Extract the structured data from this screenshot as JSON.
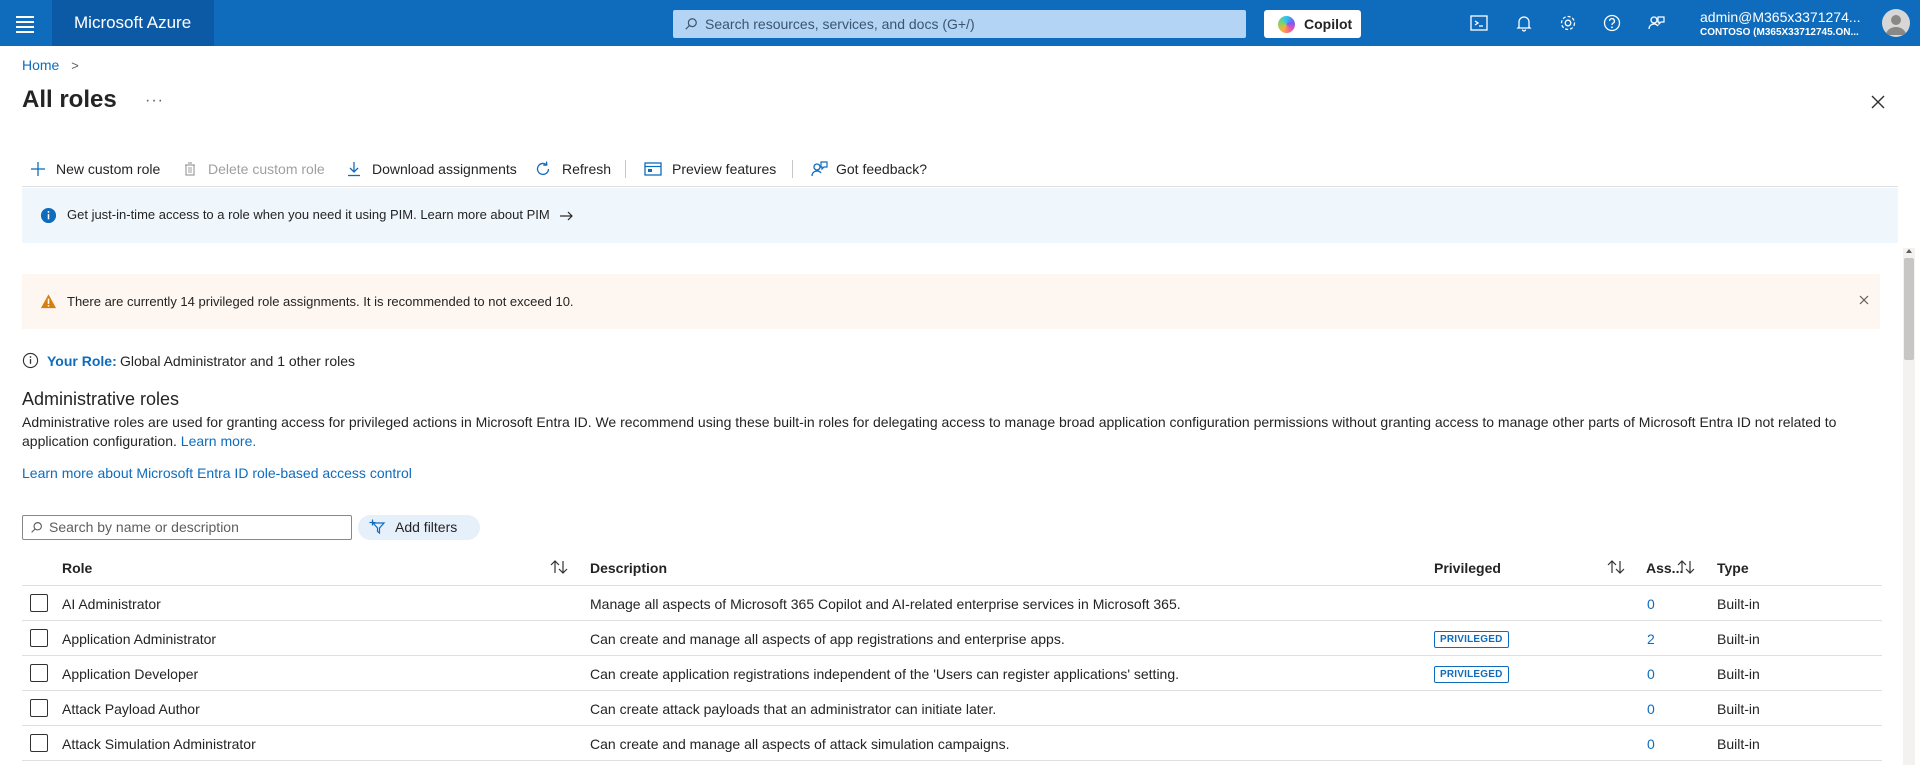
{
  "topbar": {
    "brand": "Microsoft Azure",
    "search_placeholder": "Search resources, services, and docs (G+/)",
    "copilot_label": "Copilot",
    "account_name": "admin@M365x3371274...",
    "account_tenant": "CONTOSO (M365X33712745.ON..."
  },
  "breadcrumb": {
    "home": "Home"
  },
  "page": {
    "title": "All roles",
    "more": "···"
  },
  "toolbar": {
    "new_custom_role": "New custom role",
    "delete_custom_role": "Delete custom role",
    "download_assignments": "Download assignments",
    "refresh": "Refresh",
    "preview_features": "Preview features",
    "feedback": "Got feedback?"
  },
  "info_banner": {
    "text": "Get just-in-time access to a role when you need it using PIM. Learn more about PIM"
  },
  "warning_banner": {
    "text": "There are currently 14 privileged role assignments. It is recommended to not exceed 10."
  },
  "your_role": {
    "label": "Your Role:",
    "value": "Global Administrator and 1 other roles"
  },
  "section": {
    "title": "Administrative roles",
    "description": "Administrative roles are used for granting access for privileged actions in Microsoft Entra ID. We recommend using these built-in roles for delegating access to manage broad application configuration permissions without granting access to manage other parts of Microsoft Entra ID not related to application configuration.",
    "learn_more": "Learn more.",
    "rbac_link": "Learn more about Microsoft Entra ID role-based access control"
  },
  "filters": {
    "search_placeholder": "Search by name or description",
    "add_filters": "Add filters"
  },
  "table": {
    "columns": {
      "role": "Role",
      "description": "Description",
      "privileged": "Privileged",
      "assignments": "Ass...",
      "type": "Type"
    },
    "rows": [
      {
        "role": "AI Administrator",
        "description": "Manage all aspects of Microsoft 365 Copilot and AI-related enterprise services in Microsoft 365.",
        "privileged": "",
        "assignments": "0",
        "type": "Built-in"
      },
      {
        "role": "Application Administrator",
        "description": "Can create and manage all aspects of app registrations and enterprise apps.",
        "privileged": "PRIVILEGED",
        "assignments": "2",
        "type": "Built-in"
      },
      {
        "role": "Application Developer",
        "description": "Can create application registrations independent of the 'Users can register applications' setting.",
        "privileged": "PRIVILEGED",
        "assignments": "0",
        "type": "Built-in"
      },
      {
        "role": "Attack Payload Author",
        "description": "Can create attack payloads that an administrator can initiate later.",
        "privileged": "",
        "assignments": "0",
        "type": "Built-in"
      },
      {
        "role": "Attack Simulation Administrator",
        "description": "Can create and manage all aspects of attack simulation campaigns.",
        "privileged": "",
        "assignments": "0",
        "type": "Built-in"
      }
    ]
  },
  "colors": {
    "accent": "#0f6cbd",
    "topbar": "#0f6cbd",
    "info_bg": "#eff6fc",
    "warning_bg": "#fdf6f1",
    "warning_icon": "#d67f0f"
  }
}
